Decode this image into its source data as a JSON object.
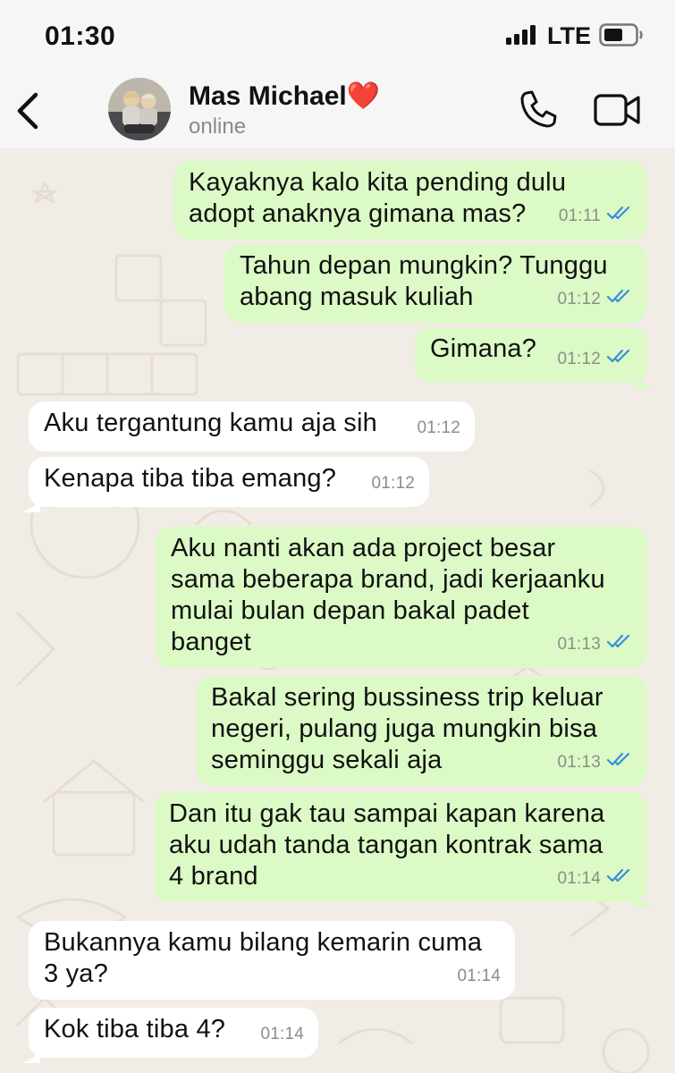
{
  "status_bar": {
    "time": "01:30",
    "network": "LTE"
  },
  "header": {
    "contact_name": "Mas Michael",
    "contact_emoji": "❤️",
    "contact_status": "online",
    "icons": [
      "back-icon",
      "avatar",
      "phone-icon",
      "video-icon"
    ]
  },
  "messages": [
    {
      "dir": "out",
      "lines": [
        "Kayaknya kalo kita pending dulu",
        "adopt anaknya gimana mas?"
      ],
      "time": "01:11",
      "read": true
    },
    {
      "dir": "out",
      "lines": [
        "Tahun depan mungkin? Tunggu",
        "abang masuk kuliah"
      ],
      "time": "01:12",
      "read": true
    },
    {
      "dir": "out",
      "lines": [
        "Gimana?"
      ],
      "time": "01:12",
      "read": true
    },
    {
      "dir": "in",
      "lines": [
        "Aku tergantung kamu aja sih"
      ],
      "time": "01:12"
    },
    {
      "dir": "in",
      "lines": [
        "Kenapa tiba tiba emang?"
      ],
      "time": "01:12"
    },
    {
      "dir": "out",
      "lines": [
        "Aku nanti akan ada project besar",
        "sama beberapa brand, jadi kerjaanku",
        "mulai bulan depan bakal padet",
        "banget"
      ],
      "time": "01:13",
      "read": true
    },
    {
      "dir": "out",
      "lines": [
        "Bakal sering bussiness trip keluar",
        "negeri, pulang juga mungkin bisa",
        "seminggu sekali aja"
      ],
      "time": "01:13",
      "read": true
    },
    {
      "dir": "out",
      "lines": [
        "Dan itu gak tau sampai kapan karena",
        "aku udah tanda tangan kontrak sama",
        "4 brand"
      ],
      "time": "01:14",
      "read": true
    },
    {
      "dir": "in",
      "lines": [
        "Bukannya kamu bilang kemarin cuma",
        "3 ya?"
      ],
      "time": "01:14"
    },
    {
      "dir": "in",
      "lines": [
        "Kok tiba tiba 4?"
      ],
      "time": "01:14"
    }
  ],
  "colors": {
    "outgoing_bubble": "#dbfac6",
    "incoming_bubble": "#ffffff",
    "read_ticks": "#3b8ddb",
    "wallpaper": "#f1ede6"
  }
}
